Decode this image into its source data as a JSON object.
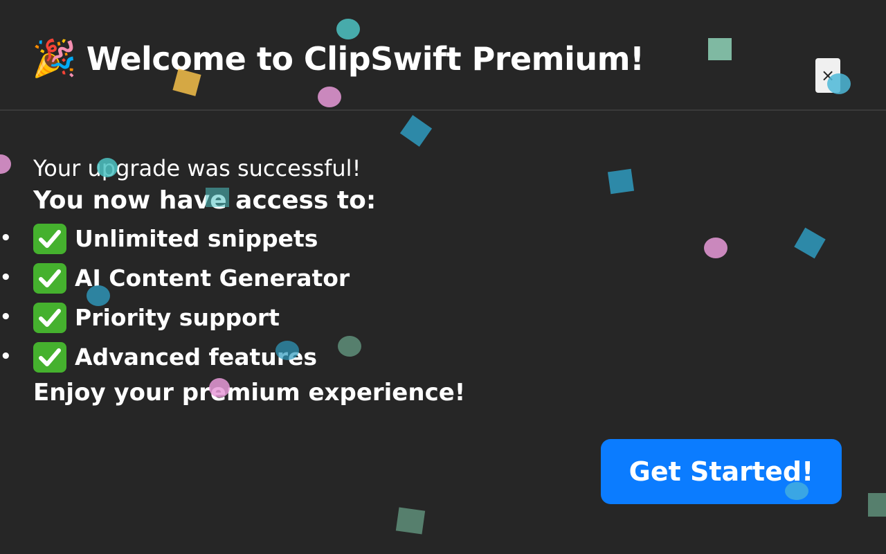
{
  "header": {
    "icon": "party-popper-icon",
    "icon_glyph": "🎉",
    "title": "Welcome to ClipSwift Premium!",
    "close_label": "×"
  },
  "content": {
    "success_text": "Your upgrade was successful!",
    "access_heading": "You now have access to:",
    "features": [
      {
        "label": "Unlimited snippets",
        "icon": "check-mark-icon"
      },
      {
        "label": "AI Content Generator",
        "icon": "check-mark-icon"
      },
      {
        "label": "Priority support",
        "icon": "check-mark-icon"
      },
      {
        "label": "Advanced features",
        "icon": "check-mark-icon"
      }
    ],
    "enjoy_text": "Enjoy your premium experience!"
  },
  "actions": {
    "get_started_label": "Get Started!"
  },
  "colors": {
    "background": "#262626",
    "accent": "#0b7cff",
    "check_green": "#45b12e",
    "confetti": [
      "#4ec3c3",
      "#e79ad8",
      "#f5c04a",
      "#2f9bbf",
      "#8fd3b8",
      "#5f8f7a"
    ]
  }
}
